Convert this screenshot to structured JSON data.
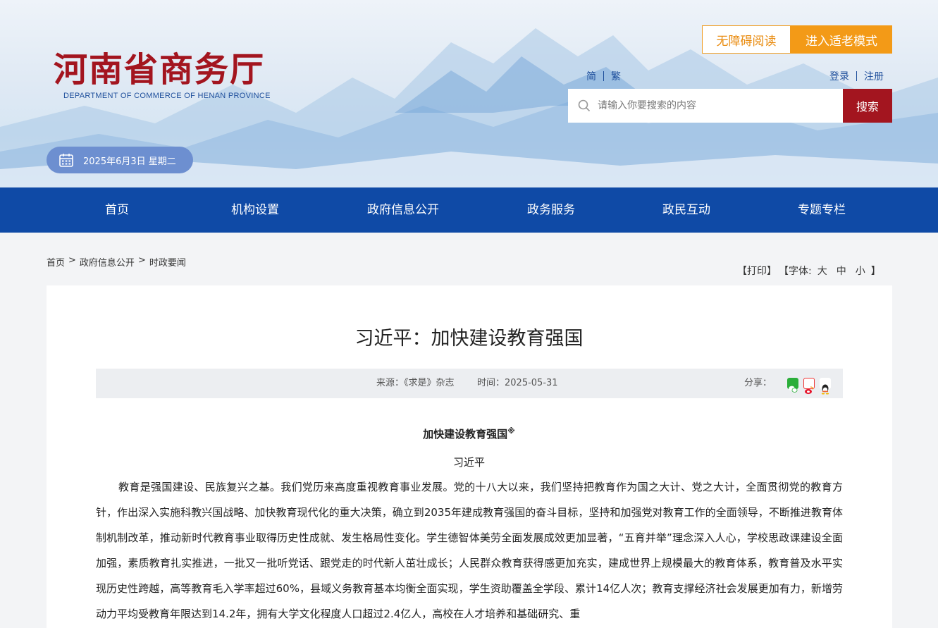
{
  "header": {
    "site_title": "河南省商务厅",
    "site_subtitle": "DEPARTMENT OF COMMERCE OF HENAN PROVINCE",
    "accessible_label": "无障碍阅读",
    "elder_mode_label": "进入适老模式",
    "lang_simplified": "简",
    "lang_traditional": "繁",
    "login_label": "登录",
    "register_label": "注册",
    "search_placeholder": "请输入你要搜索的内容",
    "search_button": "搜索",
    "date": "2025年6月3日 星期二"
  },
  "nav": {
    "items": [
      {
        "label": "首页"
      },
      {
        "label": "机构设置"
      },
      {
        "label": "政府信息公开"
      },
      {
        "label": "政务服务"
      },
      {
        "label": "政民互动"
      },
      {
        "label": "专题专栏"
      }
    ]
  },
  "breadcrumb": {
    "items": [
      "首页",
      "政府信息公开",
      "时政要闻"
    ],
    "separator": ">"
  },
  "tools": {
    "print": "【打印】",
    "font_prefix": "【字体:",
    "large": "大",
    "medium": "中",
    "small": "小",
    "font_suffix": "】"
  },
  "article": {
    "title": "习近平：加快建设教育强国",
    "source": "来源：《求是》杂志",
    "time": "时间：2025-05-31",
    "share_label": "分享：",
    "share_icons": [
      "wechat-icon",
      "weibo-icon",
      "qq-icon"
    ],
    "subtitle": "加快建设教育强国",
    "subtitle_mark": "※",
    "author": "习近平",
    "paragraph": "教育是强国建设、民族复兴之基。我们党历来高度重视教育事业发展。党的十八大以来，我们坚持把教育作为国之大计、党之大计，全面贯彻党的教育方针，作出深入实施科教兴国战略、加快教育现代化的重大决策，确立到2035年建成教育强国的奋斗目标，坚持和加强党对教育工作的全面领导，不断推进教育体制机制改革，推动新时代教育事业取得历史性成就、发生格局性变化。学生德智体美劳全面发展成效更加显著，“五育并举”理念深入人心，学校思政课建设全面加强，素质教育扎实推进，一批又一批听党话、跟党走的时代新人茁壮成长；人民群众教育获得感更加充实，建成世界上规模最大的教育体系，教育普及水平实现历史性跨越，高等教育毛入学率超过60%，县域义务教育基本均衡全面实现，学生资助覆盖全学段、累计14亿人次；教育支撑经济社会发展更加有力，新增劳动力平均受教育年限达到14.2年，拥有大学文化程度人口超过2.4亿人，高校在人才培养和基础研究、重"
  },
  "colors": {
    "brand_red": "#a3151f",
    "nav_blue": "#0f4aa6",
    "accent_orange": "#f39a17",
    "link_blue": "#1f4f9c"
  }
}
